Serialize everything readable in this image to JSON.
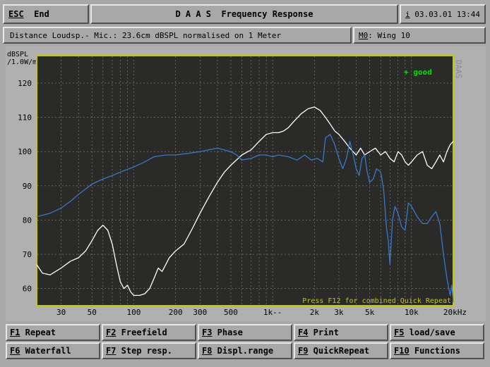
{
  "header": {
    "esc_label": "ESC",
    "end_label": "End",
    "title": "D A A S  Frequency Response",
    "info_icon": "i",
    "datetime": "03.03.01 13:44"
  },
  "subheader": {
    "description": "Distance Loudsp.- Mic.: 23.6cm dBSPL normalised on 1 Meter",
    "memory_key": "M0",
    "memory_value": ": Wing 10"
  },
  "plot": {
    "y_unit_line1": "dBSPL",
    "y_unit_line2": "/1.0W/m",
    "status_text": "+ good",
    "watermark": "DAAS",
    "hint": "Press F12 for combined Quick Repeat",
    "colors": {
      "background": "#2a2a28",
      "border": "#c8c800",
      "white_curve": "#ffffff",
      "blue_curve": "#3a78c8",
      "good": "#00e000",
      "grid": "#8a8a80"
    }
  },
  "chart_data": {
    "type": "line",
    "title": "Frequency Response",
    "xlabel": "",
    "ylabel": "dBSPL /1.0W/m",
    "x_scale": "log",
    "xlim": [
      20,
      20000
    ],
    "ylim": [
      55,
      128
    ],
    "grid": true,
    "x_tick_labels": [
      {
        "f": 30,
        "label": "30"
      },
      {
        "f": 50,
        "label": "50"
      },
      {
        "f": 100,
        "label": "100"
      },
      {
        "f": 200,
        "label": "200"
      },
      {
        "f": 300,
        "label": "300"
      },
      {
        "f": 500,
        "label": "500"
      },
      {
        "f": 1000,
        "label": "1k--"
      },
      {
        "f": 2000,
        "label": "2k"
      },
      {
        "f": 3000,
        "label": "3k"
      },
      {
        "f": 5000,
        "label": "5k"
      },
      {
        "f": 10000,
        "label": "10k"
      },
      {
        "f": 20000,
        "label": "20kHz"
      }
    ],
    "y_ticks": [
      60,
      70,
      80,
      90,
      100,
      110,
      120
    ],
    "series": [
      {
        "color": "white",
        "points": [
          [
            20,
            67
          ],
          [
            22,
            64.5
          ],
          [
            25,
            64
          ],
          [
            30,
            66
          ],
          [
            35,
            68
          ],
          [
            40,
            69
          ],
          [
            45,
            71
          ],
          [
            50,
            74
          ],
          [
            55,
            77
          ],
          [
            60,
            78.5
          ],
          [
            65,
            77
          ],
          [
            70,
            73
          ],
          [
            75,
            67
          ],
          [
            80,
            62
          ],
          [
            85,
            60
          ],
          [
            90,
            61
          ],
          [
            95,
            59
          ],
          [
            100,
            58
          ],
          [
            110,
            58
          ],
          [
            120,
            58.5
          ],
          [
            130,
            60
          ],
          [
            140,
            63
          ],
          [
            150,
            66
          ],
          [
            160,
            65
          ],
          [
            170,
            67
          ],
          [
            180,
            69
          ],
          [
            200,
            71
          ],
          [
            230,
            73
          ],
          [
            260,
            77
          ],
          [
            300,
            82
          ],
          [
            350,
            87
          ],
          [
            400,
            91
          ],
          [
            450,
            94
          ],
          [
            500,
            96
          ],
          [
            600,
            99
          ],
          [
            700,
            100.5
          ],
          [
            800,
            103
          ],
          [
            900,
            105
          ],
          [
            1000,
            105.5
          ],
          [
            1100,
            105.5
          ],
          [
            1200,
            106
          ],
          [
            1300,
            107
          ],
          [
            1400,
            108.5
          ],
          [
            1600,
            111
          ],
          [
            1800,
            112.5
          ],
          [
            2000,
            113
          ],
          [
            2200,
            112
          ],
          [
            2400,
            110
          ],
          [
            2600,
            108
          ],
          [
            2800,
            106
          ],
          [
            3000,
            105
          ],
          [
            3300,
            103
          ],
          [
            3600,
            101
          ],
          [
            4000,
            99
          ],
          [
            4300,
            101
          ],
          [
            4600,
            99
          ],
          [
            5000,
            100
          ],
          [
            5500,
            101
          ],
          [
            6000,
            99
          ],
          [
            6500,
            100
          ],
          [
            7000,
            98
          ],
          [
            7500,
            97
          ],
          [
            8000,
            100
          ],
          [
            8500,
            99
          ],
          [
            9000,
            97
          ],
          [
            9500,
            96
          ],
          [
            10000,
            97
          ],
          [
            11000,
            99
          ],
          [
            12000,
            100
          ],
          [
            13000,
            96
          ],
          [
            14000,
            95
          ],
          [
            15000,
            97
          ],
          [
            16000,
            99
          ],
          [
            17000,
            97
          ],
          [
            18000,
            100
          ],
          [
            19000,
            102
          ],
          [
            20000,
            103
          ]
        ]
      },
      {
        "color": "blue",
        "points": [
          [
            20,
            81
          ],
          [
            25,
            82
          ],
          [
            30,
            83.5
          ],
          [
            35,
            85.5
          ],
          [
            40,
            87.5
          ],
          [
            50,
            90.5
          ],
          [
            60,
            92
          ],
          [
            70,
            93
          ],
          [
            80,
            94
          ],
          [
            100,
            95.5
          ],
          [
            120,
            97
          ],
          [
            140,
            98.5
          ],
          [
            170,
            99
          ],
          [
            200,
            99
          ],
          [
            250,
            99.5
          ],
          [
            300,
            100
          ],
          [
            400,
            101
          ],
          [
            500,
            100
          ],
          [
            550,
            99
          ],
          [
            600,
            97.5
          ],
          [
            700,
            98
          ],
          [
            800,
            99
          ],
          [
            900,
            99
          ],
          [
            1000,
            98.5
          ],
          [
            1100,
            99
          ],
          [
            1300,
            98.5
          ],
          [
            1500,
            97.5
          ],
          [
            1700,
            99
          ],
          [
            1900,
            97.5
          ],
          [
            2100,
            98
          ],
          [
            2300,
            97
          ],
          [
            2400,
            104
          ],
          [
            2600,
            105
          ],
          [
            2800,
            102
          ],
          [
            3000,
            98
          ],
          [
            3200,
            95
          ],
          [
            3400,
            98
          ],
          [
            3600,
            103
          ],
          [
            3800,
            99
          ],
          [
            4000,
            95
          ],
          [
            4200,
            93
          ],
          [
            4400,
            98
          ],
          [
            4600,
            99
          ],
          [
            4800,
            94
          ],
          [
            5000,
            91
          ],
          [
            5300,
            92
          ],
          [
            5600,
            95
          ],
          [
            6000,
            94
          ],
          [
            6300,
            89
          ],
          [
            6600,
            78
          ],
          [
            6800,
            74
          ],
          [
            7000,
            67
          ],
          [
            7300,
            80
          ],
          [
            7600,
            84
          ],
          [
            8000,
            82
          ],
          [
            8500,
            78
          ],
          [
            9000,
            77
          ],
          [
            9500,
            85
          ],
          [
            10000,
            84
          ],
          [
            11000,
            81
          ],
          [
            12000,
            79
          ],
          [
            13000,
            79
          ],
          [
            14000,
            81
          ],
          [
            15000,
            82.5
          ],
          [
            16000,
            79
          ],
          [
            17000,
            70
          ],
          [
            18000,
            63
          ],
          [
            19000,
            58
          ],
          [
            19500,
            61
          ],
          [
            20000,
            56
          ]
        ]
      }
    ]
  },
  "fkeys": [
    {
      "key": "F1",
      "label": " Repeat"
    },
    {
      "key": "F2",
      "label": " Freefield"
    },
    {
      "key": "F3",
      "label": " Phase"
    },
    {
      "key": "F4",
      "label": " Print"
    },
    {
      "key": "F5",
      "label": " load/save"
    },
    {
      "key": "F6",
      "label": " Waterfall"
    },
    {
      "key": "F7",
      "label": " Step resp."
    },
    {
      "key": "F8",
      "label": " Displ.range"
    },
    {
      "key": "F9",
      "label": " QuickRepeat"
    },
    {
      "key": "F10",
      "label": " Functions"
    }
  ]
}
